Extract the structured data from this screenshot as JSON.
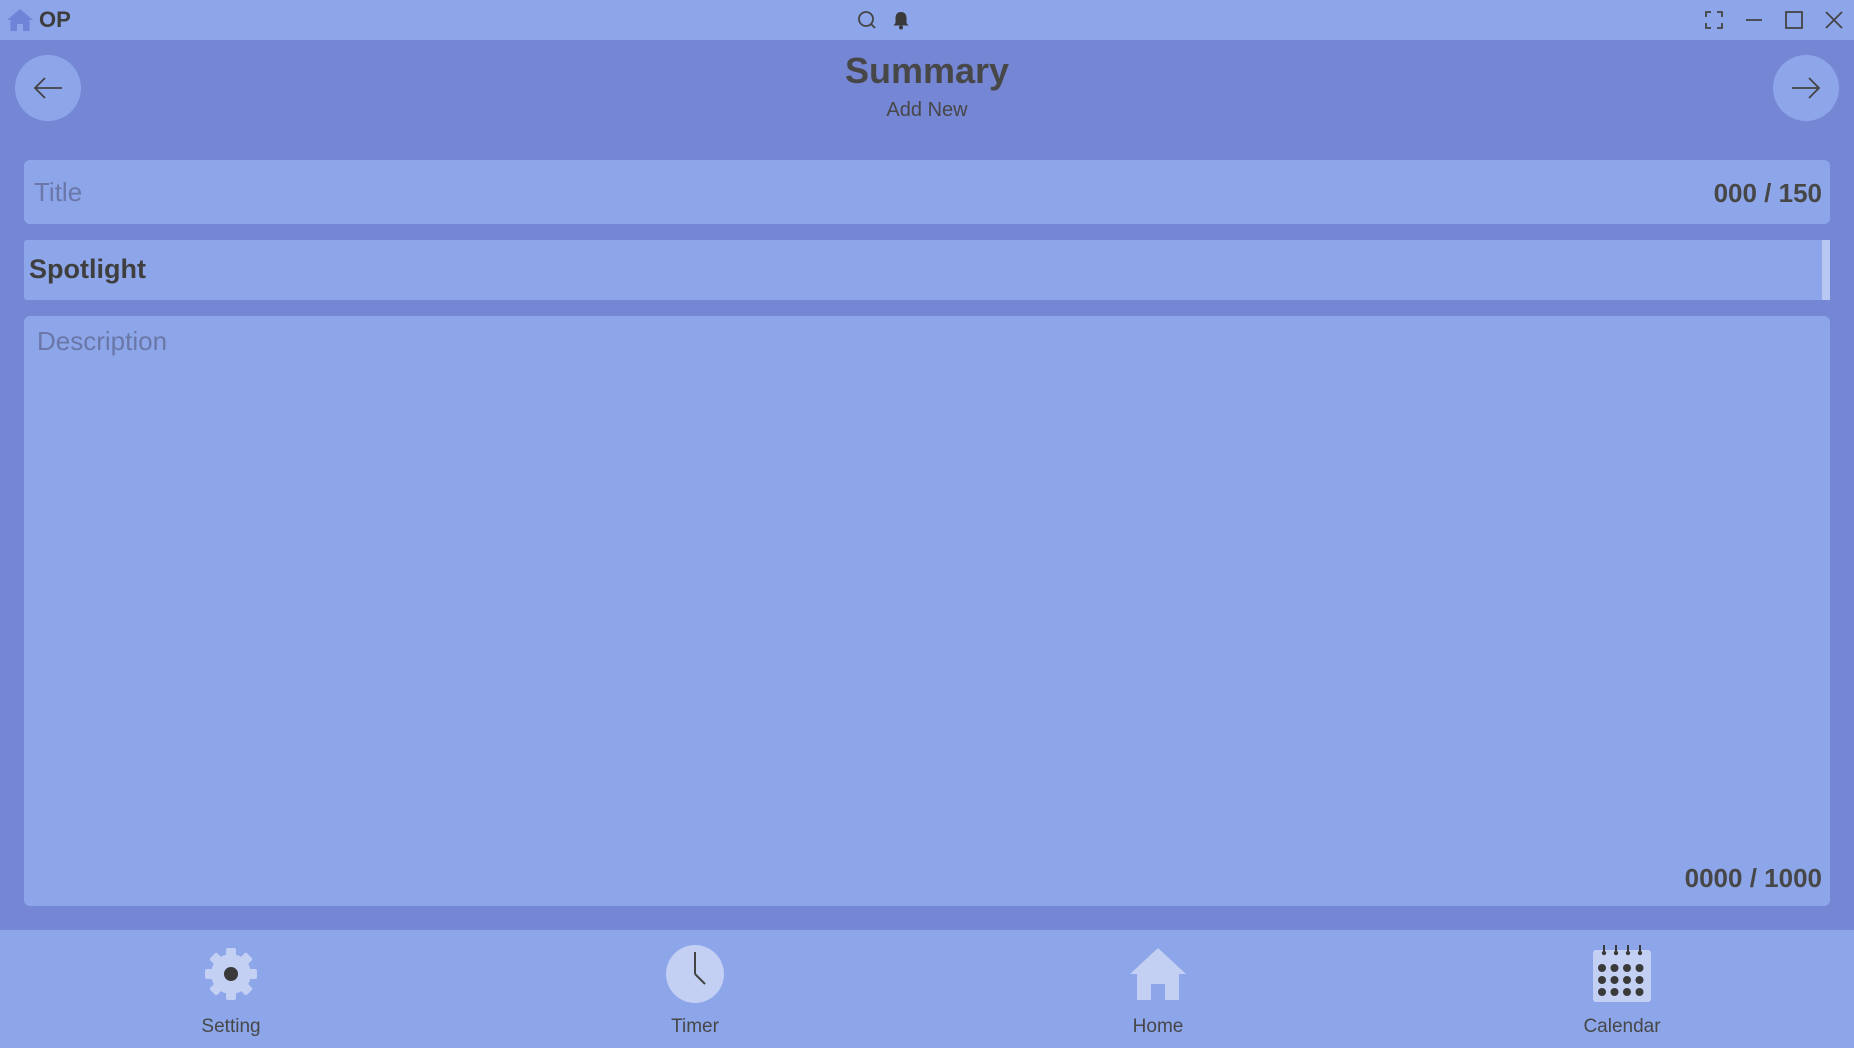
{
  "window": {
    "app_name": "OP",
    "logo_icon": "home-icon",
    "icons": [
      "search-icon",
      "bell-icon",
      "fullscreen-icon",
      "minimize-icon",
      "maximize-icon",
      "close-icon"
    ]
  },
  "header": {
    "title": "Summary",
    "subtitle": "Add New",
    "back_icon": "arrow-left-icon",
    "forward_icon": "arrow-right-icon"
  },
  "form": {
    "title_field": {
      "value": "",
      "placeholder": "Title",
      "counter": "000 / 150"
    },
    "category_select": {
      "selected": "Spotlight"
    },
    "description_field": {
      "value": "",
      "placeholder": "Description",
      "counter": "0000 / 1000"
    }
  },
  "bottom_nav": {
    "items": [
      {
        "label": "Setting",
        "icon": "gear-icon"
      },
      {
        "label": "Timer",
        "icon": "clock-icon"
      },
      {
        "label": "Home",
        "icon": "home-icon"
      },
      {
        "label": "Calendar",
        "icon": "calendar-icon"
      }
    ]
  },
  "colors": {
    "background": "#7486d4",
    "surface": "#8da6e9",
    "text": "#474747",
    "placeholder": "#6a77a8"
  }
}
